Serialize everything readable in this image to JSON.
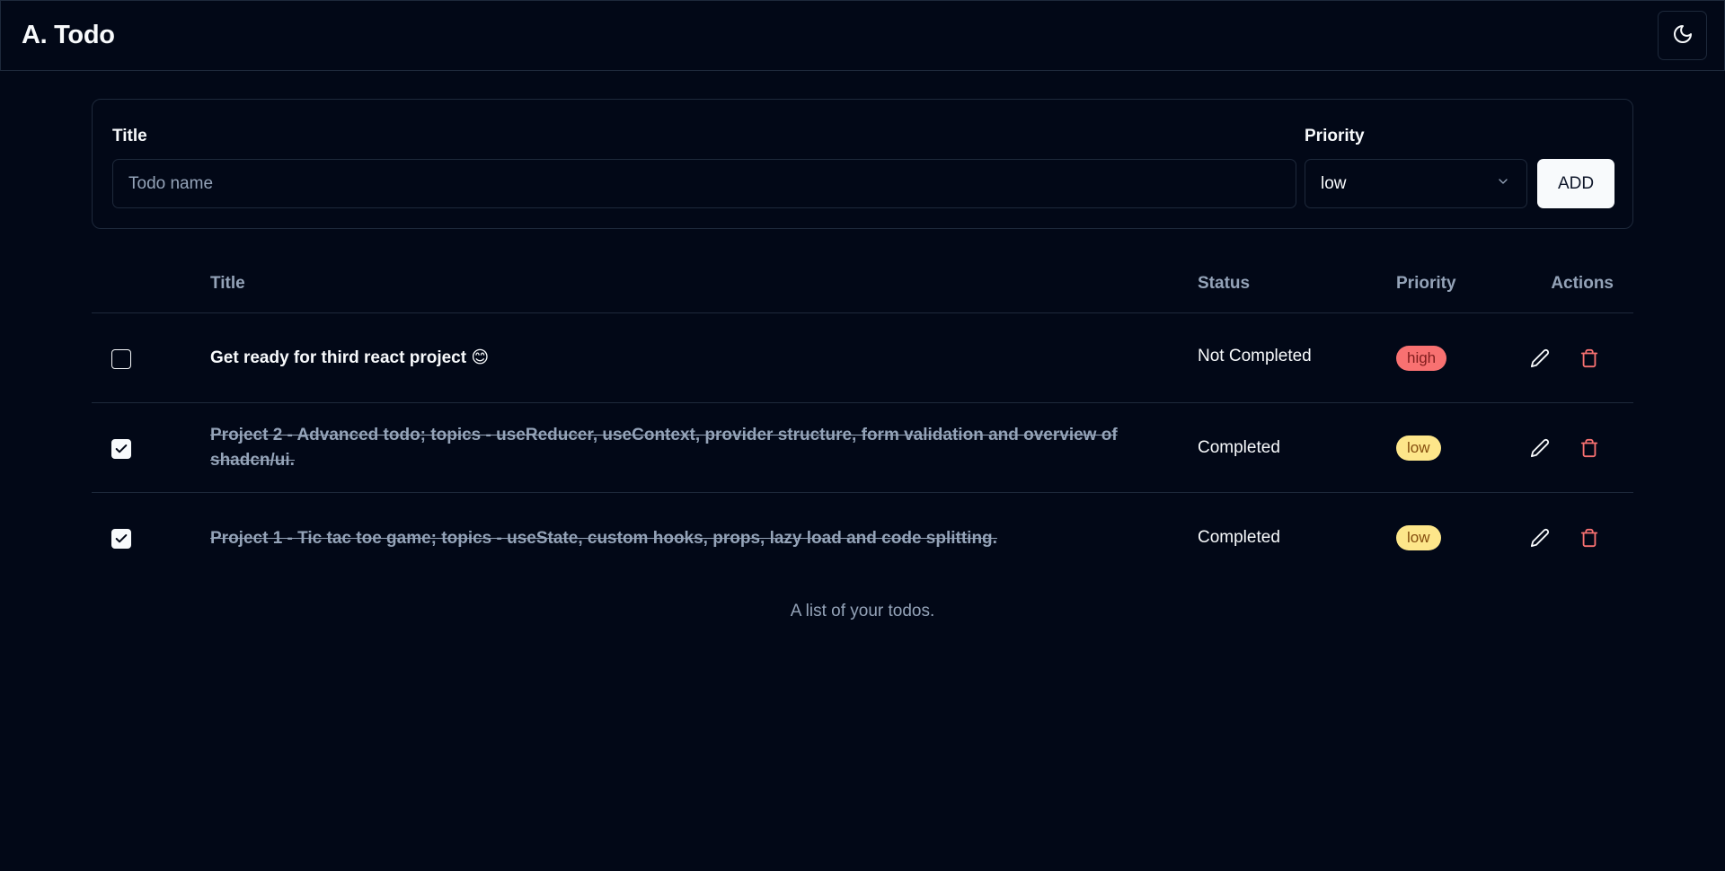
{
  "app": {
    "title": "A. Todo",
    "theme_icon": "moon-icon"
  },
  "form": {
    "title_label": "Title",
    "title_placeholder": "Todo name",
    "title_value": "",
    "priority_label": "Priority",
    "priority_value": "low",
    "add_label": "ADD"
  },
  "table": {
    "headers": {
      "title": "Title",
      "status": "Status",
      "priority": "Priority",
      "actions": "Actions"
    },
    "rows": [
      {
        "checked": false,
        "title": "Get ready for third react project 😊",
        "status": "Not Completed",
        "priority": "high"
      },
      {
        "checked": true,
        "title": "Project 2 - Advanced todo; topics - useReducer, useContext, provider structure, form validation and overview of shadcn/ui.",
        "status": "Completed",
        "priority": "low"
      },
      {
        "checked": true,
        "title": "Project 1 - Tic tac toe game; topics - useState, custom hooks, props, lazy load and code splitting.",
        "status": "Completed",
        "priority": "low"
      }
    ],
    "caption": "A list of your todos."
  },
  "colors": {
    "background": "#020817",
    "border": "#1e293b",
    "muted_text": "#94a3b8",
    "high_badge": "#f87171",
    "low_badge": "#fde68a",
    "delete_icon": "#f87171"
  }
}
